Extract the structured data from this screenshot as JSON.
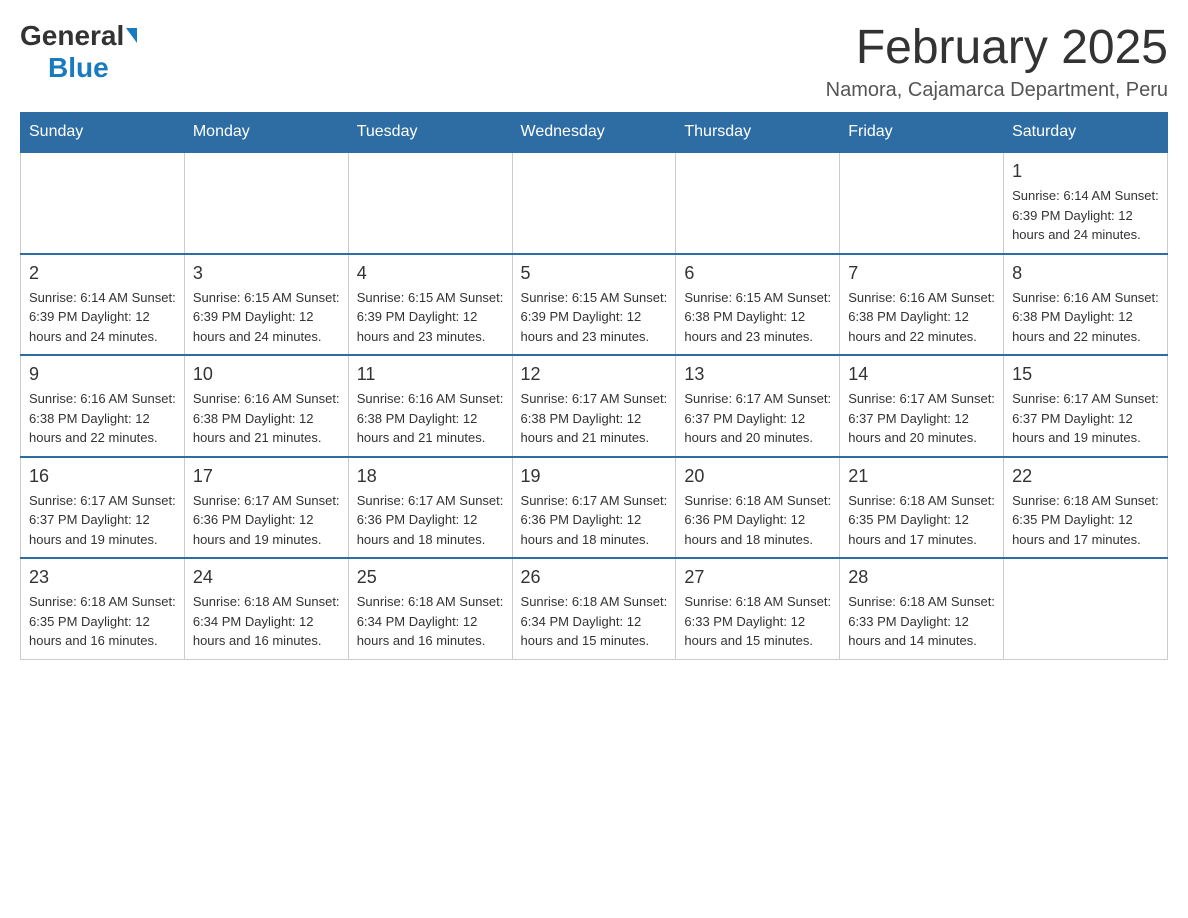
{
  "header": {
    "logo_general": "General",
    "logo_blue": "Blue",
    "title": "February 2025",
    "subtitle": "Namora, Cajamarca Department, Peru"
  },
  "days_of_week": [
    "Sunday",
    "Monday",
    "Tuesday",
    "Wednesday",
    "Thursday",
    "Friday",
    "Saturday"
  ],
  "weeks": [
    {
      "days": [
        {
          "date": "",
          "info": ""
        },
        {
          "date": "",
          "info": ""
        },
        {
          "date": "",
          "info": ""
        },
        {
          "date": "",
          "info": ""
        },
        {
          "date": "",
          "info": ""
        },
        {
          "date": "",
          "info": ""
        },
        {
          "date": "1",
          "info": "Sunrise: 6:14 AM\nSunset: 6:39 PM\nDaylight: 12 hours and 24 minutes."
        }
      ]
    },
    {
      "days": [
        {
          "date": "2",
          "info": "Sunrise: 6:14 AM\nSunset: 6:39 PM\nDaylight: 12 hours and 24 minutes."
        },
        {
          "date": "3",
          "info": "Sunrise: 6:15 AM\nSunset: 6:39 PM\nDaylight: 12 hours and 24 minutes."
        },
        {
          "date": "4",
          "info": "Sunrise: 6:15 AM\nSunset: 6:39 PM\nDaylight: 12 hours and 23 minutes."
        },
        {
          "date": "5",
          "info": "Sunrise: 6:15 AM\nSunset: 6:39 PM\nDaylight: 12 hours and 23 minutes."
        },
        {
          "date": "6",
          "info": "Sunrise: 6:15 AM\nSunset: 6:38 PM\nDaylight: 12 hours and 23 minutes."
        },
        {
          "date": "7",
          "info": "Sunrise: 6:16 AM\nSunset: 6:38 PM\nDaylight: 12 hours and 22 minutes."
        },
        {
          "date": "8",
          "info": "Sunrise: 6:16 AM\nSunset: 6:38 PM\nDaylight: 12 hours and 22 minutes."
        }
      ]
    },
    {
      "days": [
        {
          "date": "9",
          "info": "Sunrise: 6:16 AM\nSunset: 6:38 PM\nDaylight: 12 hours and 22 minutes."
        },
        {
          "date": "10",
          "info": "Sunrise: 6:16 AM\nSunset: 6:38 PM\nDaylight: 12 hours and 21 minutes."
        },
        {
          "date": "11",
          "info": "Sunrise: 6:16 AM\nSunset: 6:38 PM\nDaylight: 12 hours and 21 minutes."
        },
        {
          "date": "12",
          "info": "Sunrise: 6:17 AM\nSunset: 6:38 PM\nDaylight: 12 hours and 21 minutes."
        },
        {
          "date": "13",
          "info": "Sunrise: 6:17 AM\nSunset: 6:37 PM\nDaylight: 12 hours and 20 minutes."
        },
        {
          "date": "14",
          "info": "Sunrise: 6:17 AM\nSunset: 6:37 PM\nDaylight: 12 hours and 20 minutes."
        },
        {
          "date": "15",
          "info": "Sunrise: 6:17 AM\nSunset: 6:37 PM\nDaylight: 12 hours and 19 minutes."
        }
      ]
    },
    {
      "days": [
        {
          "date": "16",
          "info": "Sunrise: 6:17 AM\nSunset: 6:37 PM\nDaylight: 12 hours and 19 minutes."
        },
        {
          "date": "17",
          "info": "Sunrise: 6:17 AM\nSunset: 6:36 PM\nDaylight: 12 hours and 19 minutes."
        },
        {
          "date": "18",
          "info": "Sunrise: 6:17 AM\nSunset: 6:36 PM\nDaylight: 12 hours and 18 minutes."
        },
        {
          "date": "19",
          "info": "Sunrise: 6:17 AM\nSunset: 6:36 PM\nDaylight: 12 hours and 18 minutes."
        },
        {
          "date": "20",
          "info": "Sunrise: 6:18 AM\nSunset: 6:36 PM\nDaylight: 12 hours and 18 minutes."
        },
        {
          "date": "21",
          "info": "Sunrise: 6:18 AM\nSunset: 6:35 PM\nDaylight: 12 hours and 17 minutes."
        },
        {
          "date": "22",
          "info": "Sunrise: 6:18 AM\nSunset: 6:35 PM\nDaylight: 12 hours and 17 minutes."
        }
      ]
    },
    {
      "days": [
        {
          "date": "23",
          "info": "Sunrise: 6:18 AM\nSunset: 6:35 PM\nDaylight: 12 hours and 16 minutes."
        },
        {
          "date": "24",
          "info": "Sunrise: 6:18 AM\nSunset: 6:34 PM\nDaylight: 12 hours and 16 minutes."
        },
        {
          "date": "25",
          "info": "Sunrise: 6:18 AM\nSunset: 6:34 PM\nDaylight: 12 hours and 16 minutes."
        },
        {
          "date": "26",
          "info": "Sunrise: 6:18 AM\nSunset: 6:34 PM\nDaylight: 12 hours and 15 minutes."
        },
        {
          "date": "27",
          "info": "Sunrise: 6:18 AM\nSunset: 6:33 PM\nDaylight: 12 hours and 15 minutes."
        },
        {
          "date": "28",
          "info": "Sunrise: 6:18 AM\nSunset: 6:33 PM\nDaylight: 12 hours and 14 minutes."
        },
        {
          "date": "",
          "info": ""
        }
      ]
    }
  ]
}
